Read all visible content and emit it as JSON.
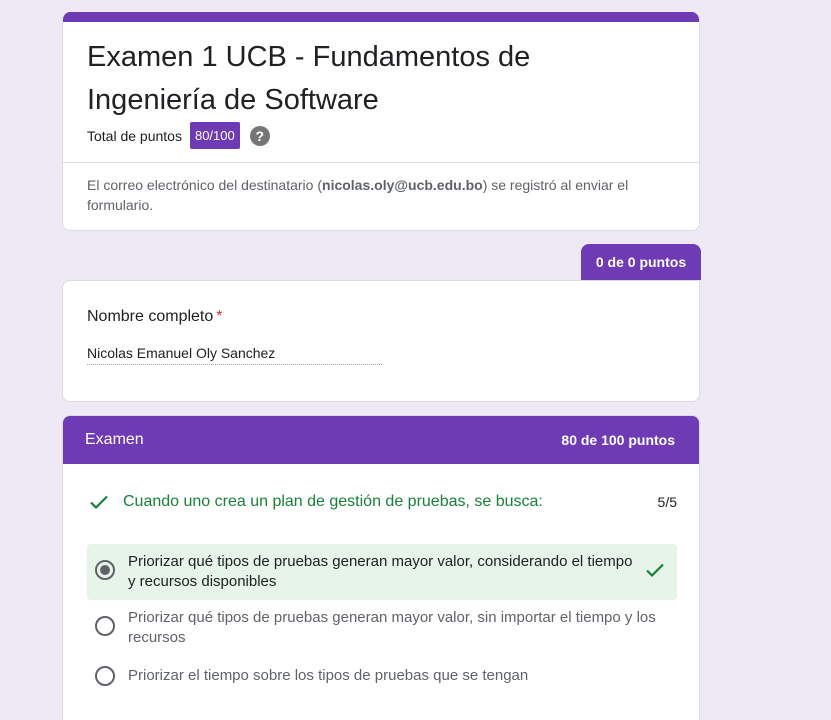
{
  "form": {
    "title": "Examen 1 UCB - Fundamentos de Ingeniería de Software",
    "total_points_label": "Total de puntos",
    "total_points_value": "80/100",
    "help_icon": "help-icon",
    "email_note_prefix": "El correo electrónico del destinatario (",
    "email": "nicolas.oly@ucb.edu.bo",
    "email_note_suffix": ") se registró al enviar el formulario."
  },
  "section_points": "0 de 0 puntos",
  "name_question": {
    "label": "Nombre completo",
    "required_mark": "*",
    "answer": "Nicolas Emanuel Oly Sanchez"
  },
  "exam": {
    "title": "Examen",
    "points": "80 de 100 puntos",
    "question": {
      "text": "Cuando uno crea un plan de gestión de pruebas, se busca:",
      "score": "5/5",
      "options": [
        {
          "label": "Priorizar qué tipos de pruebas generan mayor valor, considerando el tiempo y recursos disponibles",
          "selected": true,
          "correct": true
        },
        {
          "label": "Priorizar qué tipos de pruebas generan mayor valor, sin importar el tiempo y los recursos",
          "selected": false,
          "correct": false
        },
        {
          "label": "Priorizar el tiempo sobre los tipos de pruebas que se tengan",
          "selected": false,
          "correct": false
        }
      ]
    }
  },
  "colors": {
    "accent": "#6f3bb5",
    "background": "#efe8f5",
    "correct_green": "#188038",
    "correct_bg": "#e6f4ea",
    "required_red": "#d93025"
  }
}
